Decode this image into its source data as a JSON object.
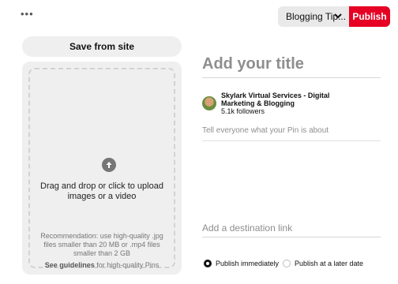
{
  "header": {
    "more_label": "•••",
    "board_select": {
      "value": "Blogging Tip..."
    },
    "publish_label": "Publish"
  },
  "upload": {
    "save_from_site_label": "Save from site",
    "drag_text": "Drag and drop or click to upload images or a video",
    "recommendation": "Recommendation: use high-quality .jpg files smaller than 20 MB or .mp4 files smaller than 2 GB",
    "guidelines_link": "See guidelines",
    "guidelines_tail": " for high-quality Pins"
  },
  "form": {
    "title_placeholder": "Add your title",
    "profile_name": "Skylark Virtual Services - Digital Marketing & Blogging",
    "followers": "5.1k followers",
    "description_placeholder": "Tell everyone what your Pin is about",
    "destination_placeholder": "Add a destination link"
  },
  "publish_options": {
    "immediately": "Publish immediately",
    "later": "Publish at a later date",
    "selected": "immediately"
  },
  "colors": {
    "brand": "#e60023",
    "panel": "#efefef"
  }
}
